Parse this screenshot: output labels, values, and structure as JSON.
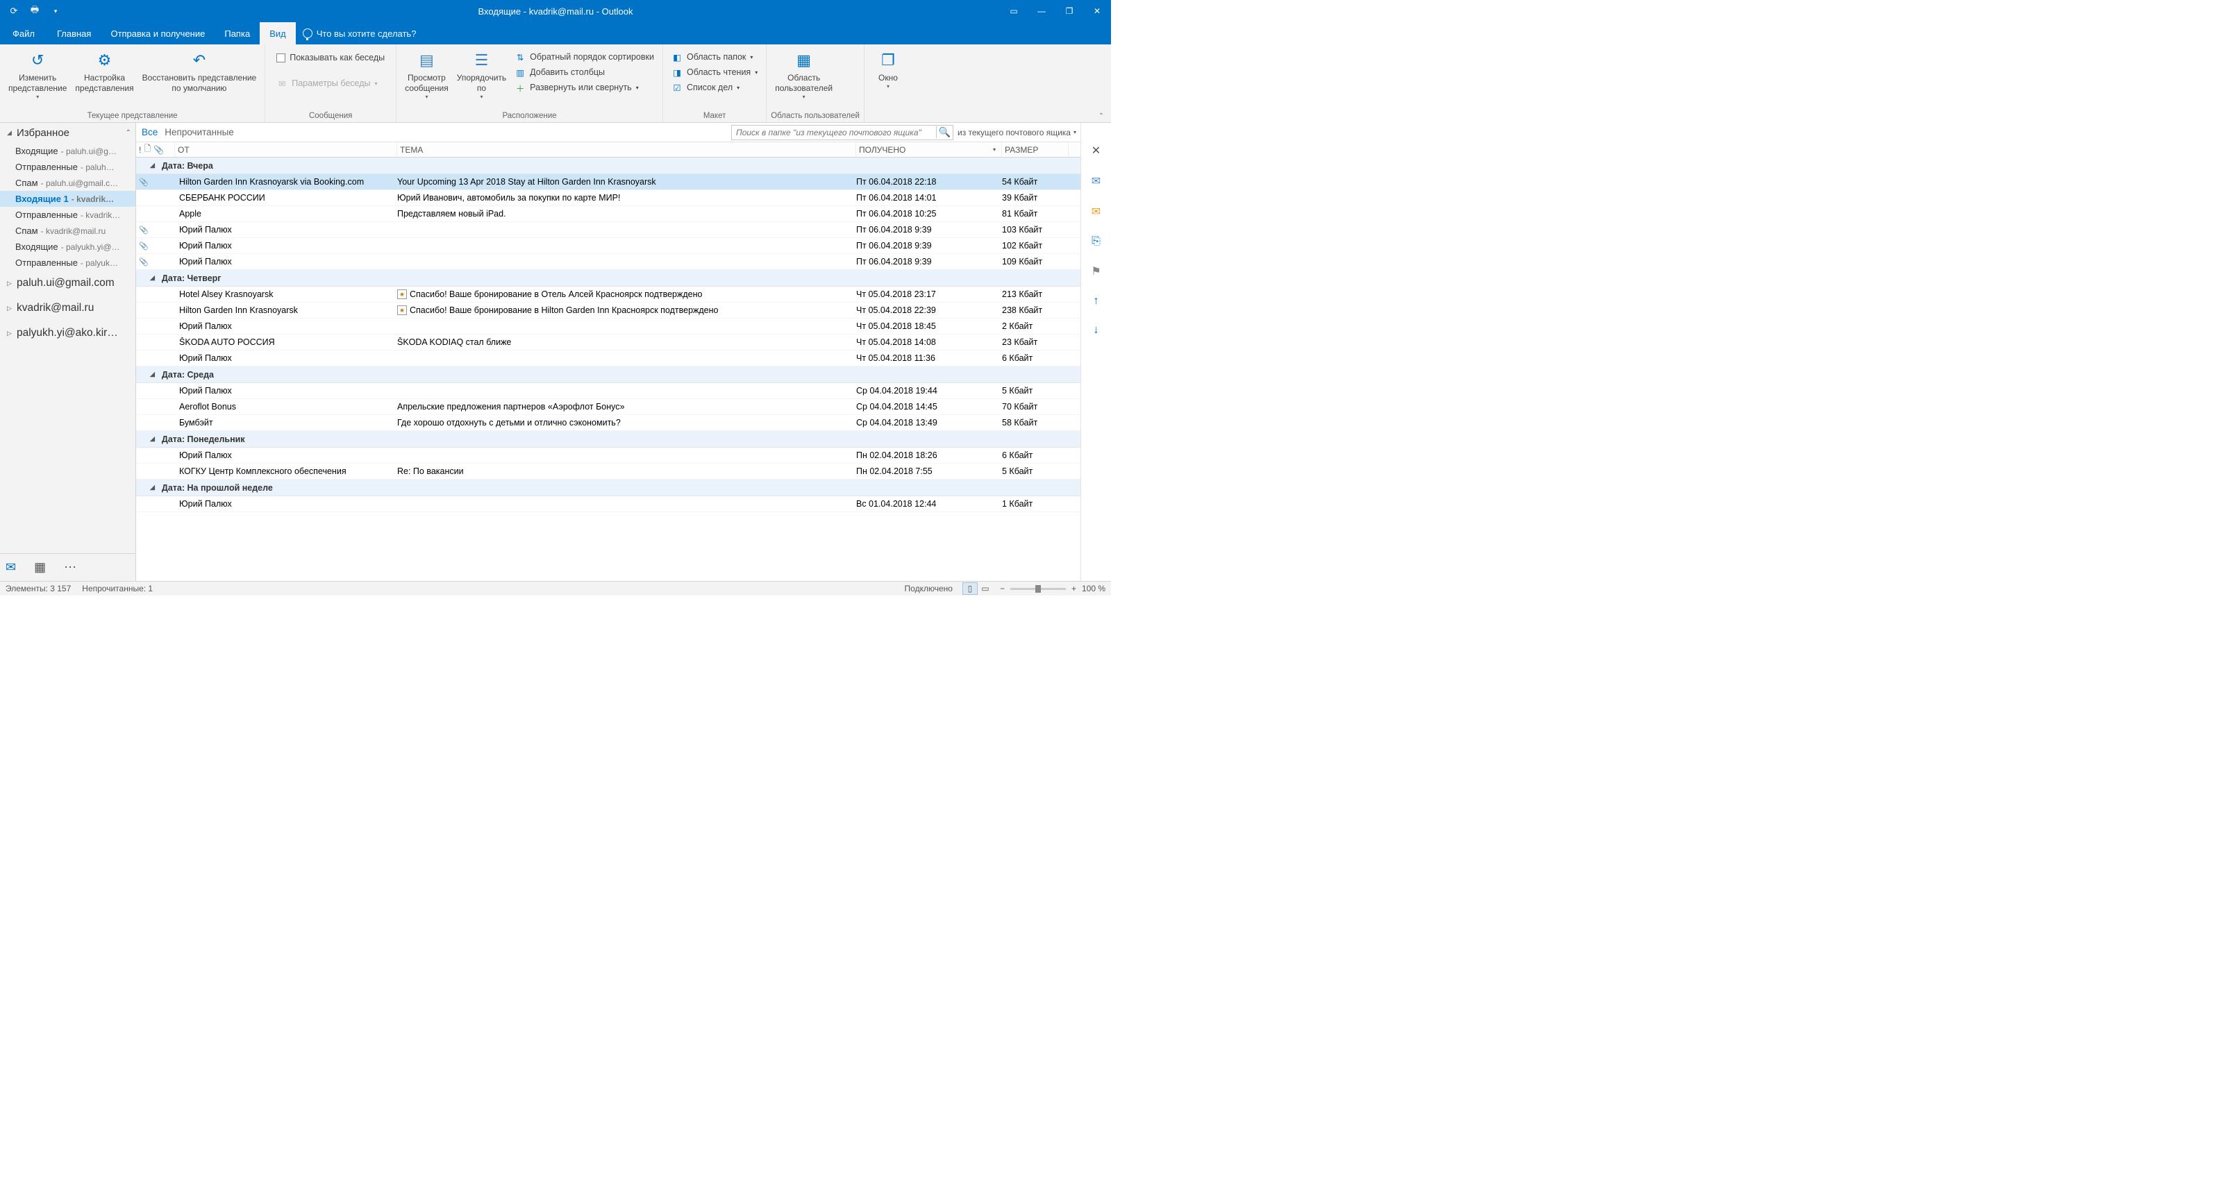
{
  "window_title": "Входящие - kvadrik@mail.ru  -  Outlook",
  "ribbon_tabs": {
    "file": "Файл",
    "home": "Главная",
    "sendreceive": "Отправка и получение",
    "folder": "Папка",
    "view": "Вид",
    "tellme": "Что вы хотите сделать?"
  },
  "ribbon": {
    "g1": {
      "change_view": "Изменить\nпредставление",
      "view_settings": "Настройка\nпредставления",
      "reset_view": "Восстановить представление\nпо умолчанию",
      "label": "Текущее представление"
    },
    "g2": {
      "show_as_conv": "Показывать как беседы",
      "conv_settings": "Параметры беседы",
      "label": "Сообщения"
    },
    "g3": {
      "preview": "Просмотр\nсообщения",
      "arrange": "Упорядочить\nпо",
      "reverse": "Обратный порядок сортировки",
      "add_cols": "Добавить столбцы",
      "expand": "Развернуть или свернуть",
      "label": "Расположение"
    },
    "g4": {
      "folder_pane": "Область папок",
      "reading_pane": "Область чтения",
      "todo_bar": "Список дел",
      "label": "Макет"
    },
    "g5": {
      "people_pane": "Область\nпользователей",
      "label": "Область пользователей"
    },
    "g6": {
      "window": "Окно"
    }
  },
  "sidebar": {
    "favorites": "Избранное",
    "items": [
      {
        "name": "Входящие",
        "sub": " - paluh.ui@g…"
      },
      {
        "name": "Отправленные",
        "sub": " - paluh…"
      },
      {
        "name": "Спам",
        "sub": " - paluh.ui@gmail.c…"
      },
      {
        "name": "Входящие  1",
        "sub": " - kvadrik…",
        "bold": true,
        "selected": true
      },
      {
        "name": "Отправленные",
        "sub": " - kvadrik…"
      },
      {
        "name": "Спам",
        "sub": " - kvadrik@mail.ru"
      },
      {
        "name": "Входящие",
        "sub": " - palyukh.yi@…"
      },
      {
        "name": "Отправленные",
        "sub": " - palyuk…"
      }
    ],
    "accounts": [
      "paluh.ui@gmail.com",
      "kvadrik@mail.ru",
      "palyukh.yi@ako.kir…"
    ]
  },
  "filters": {
    "all": "Все",
    "unread": "Непрочитанные"
  },
  "search": {
    "placeholder": "Поиск в папке \"из текущего почтового ящика\"",
    "scope": "из текущего почтового ящика"
  },
  "columns": {
    "from": "ОТ",
    "subject": "ТЕМА",
    "received": "ПОЛУЧЕНО",
    "size": "РАЗМЕР"
  },
  "groups": [
    {
      "title": "Дата: Вчера",
      "rows": [
        {
          "attach": true,
          "from": "Hilton Garden Inn Krasnoyarsk via Booking.com",
          "subj": "Your Upcoming 13 Apr 2018 Stay at Hilton Garden Inn Krasnoyarsk",
          "date": "Пт 06.04.2018 22:18",
          "size": "54 Кбайт",
          "selected": true
        },
        {
          "from": "СБЕРБАНК РОССИИ",
          "subj": "Юрий Иванович, автомобиль за покупки по карте МИР!",
          "date": "Пт 06.04.2018 14:01",
          "size": "39 Кбайт"
        },
        {
          "from": "Apple",
          "subj": "Представляем новый iPad.",
          "date": "Пт 06.04.2018 10:25",
          "size": "81 Кбайт"
        },
        {
          "attach": true,
          "from": "Юрий Палюх",
          "subj": "",
          "date": "Пт 06.04.2018 9:39",
          "size": "103 Кбайт"
        },
        {
          "attach": true,
          "from": "Юрий Палюх",
          "subj": "",
          "date": "Пт 06.04.2018 9:39",
          "size": "102 Кбайт"
        },
        {
          "attach": true,
          "from": "Юрий Палюх",
          "subj": "",
          "date": "Пт 06.04.2018 9:39",
          "size": "109 Кбайт"
        }
      ]
    },
    {
      "title": "Дата: Четверг",
      "rows": [
        {
          "from": "Hotel Alsey Krasnoyarsk",
          "subjicon": true,
          "subj": "Спасибо! Ваше бронирование в Отель Алсей Красноярск подтверждено",
          "date": "Чт 05.04.2018 23:17",
          "size": "213 Кбайт"
        },
        {
          "from": "Hilton Garden Inn Krasnoyarsk",
          "subjicon": true,
          "subj": "Спасибо! Ваше бронирование в Hilton Garden Inn Красноярск подтверждено",
          "date": "Чт 05.04.2018 22:39",
          "size": "238 Кбайт"
        },
        {
          "from": "Юрий Палюх",
          "subj": "",
          "date": "Чт 05.04.2018 18:45",
          "size": "2 Кбайт"
        },
        {
          "from": "ŠKODA AUTO РОССИЯ",
          "subj": "ŠKODA KODIAQ стал ближе",
          "date": "Чт 05.04.2018 14:08",
          "size": "23 Кбайт"
        },
        {
          "from": "Юрий Палюх",
          "subj": "",
          "date": "Чт 05.04.2018 11:36",
          "size": "6 Кбайт"
        }
      ]
    },
    {
      "title": "Дата: Среда",
      "rows": [
        {
          "from": "Юрий Палюх",
          "subj": "",
          "date": "Ср 04.04.2018 19:44",
          "size": "5 Кбайт"
        },
        {
          "from": "Aeroflot Bonus",
          "subj": "Апрельские предложения партнеров «Аэрофлот Бонус»",
          "date": "Ср 04.04.2018 14:45",
          "size": "70 Кбайт"
        },
        {
          "from": "Бумбэйт",
          "subj": "Где хорошо отдохнуть с детьми и отлично сэкономить?",
          "date": "Ср 04.04.2018 13:49",
          "size": "58 Кбайт"
        }
      ]
    },
    {
      "title": "Дата: Понедельник",
      "rows": [
        {
          "from": "Юрий Палюх",
          "subj": "",
          "date": "Пн 02.04.2018 18:26",
          "size": "6 Кбайт"
        },
        {
          "from": "КОГКУ Центр Комплексного обеспечения",
          "subj": "Re: По вакансии",
          "date": "Пн 02.04.2018 7:55",
          "size": "5 Кбайт"
        }
      ]
    },
    {
      "title": "Дата: На прошлой неделе",
      "rows": [
        {
          "from": "Юрий Палюх",
          "subj": "",
          "date": "Вс 01.04.2018 12:44",
          "size": "1 Кбайт"
        }
      ]
    }
  ],
  "status": {
    "items": "Элементы: 3 157",
    "unread": "Непрочитанные: 1",
    "connected": "Подключено",
    "zoom": "100 %"
  }
}
